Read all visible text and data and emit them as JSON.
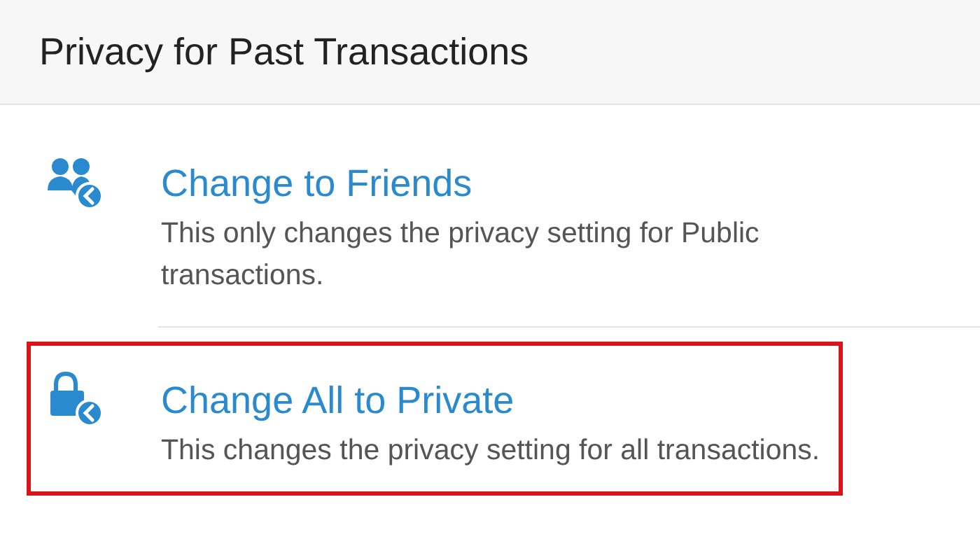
{
  "header": {
    "title": "Privacy for Past Transactions"
  },
  "options": [
    {
      "kind": "friends",
      "title": "Change to Friends",
      "description": "This only changes the privacy setting for Public transactions.",
      "highlighted": false
    },
    {
      "kind": "private",
      "title": "Change All to Private",
      "description": "This changes the privacy setting for all transactions.",
      "highlighted": true
    }
  ]
}
